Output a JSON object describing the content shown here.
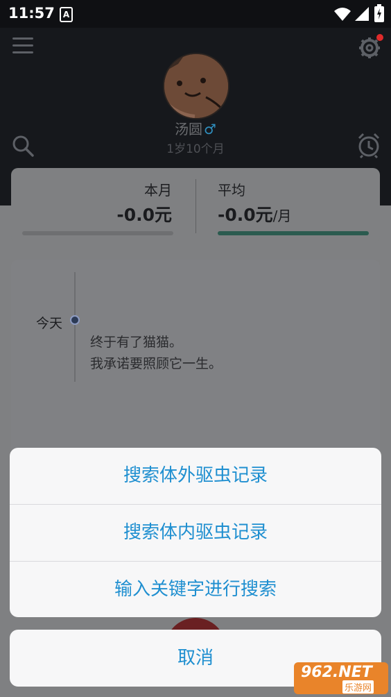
{
  "status_bar": {
    "time": "11:57",
    "notif_letter": "A"
  },
  "profile": {
    "name": "汤圆",
    "gender_symbol": "♂",
    "age": "1岁10个月"
  },
  "stats": {
    "month_label": "本月",
    "month_value": "-0.0元",
    "avg_label": "平均",
    "avg_value": "-0.0元",
    "avg_unit": "/月"
  },
  "timeline": {
    "date": "今天",
    "text_line1": "终于有了猫猫。",
    "text_line2": "我承诺要照顾它一生。"
  },
  "action_sheet": {
    "options": [
      "搜索体外驱虫记录",
      "搜索体内驱虫记录",
      "输入关键字进行搜索"
    ],
    "cancel": "取消"
  },
  "watermark": {
    "top": "962.NET",
    "bottom": "乐游网"
  },
  "colors": {
    "accent": "#1f8fd0",
    "header_bg": "#16181c",
    "badge": "#e02b2b",
    "progress_fill": "#2b5b4f"
  }
}
